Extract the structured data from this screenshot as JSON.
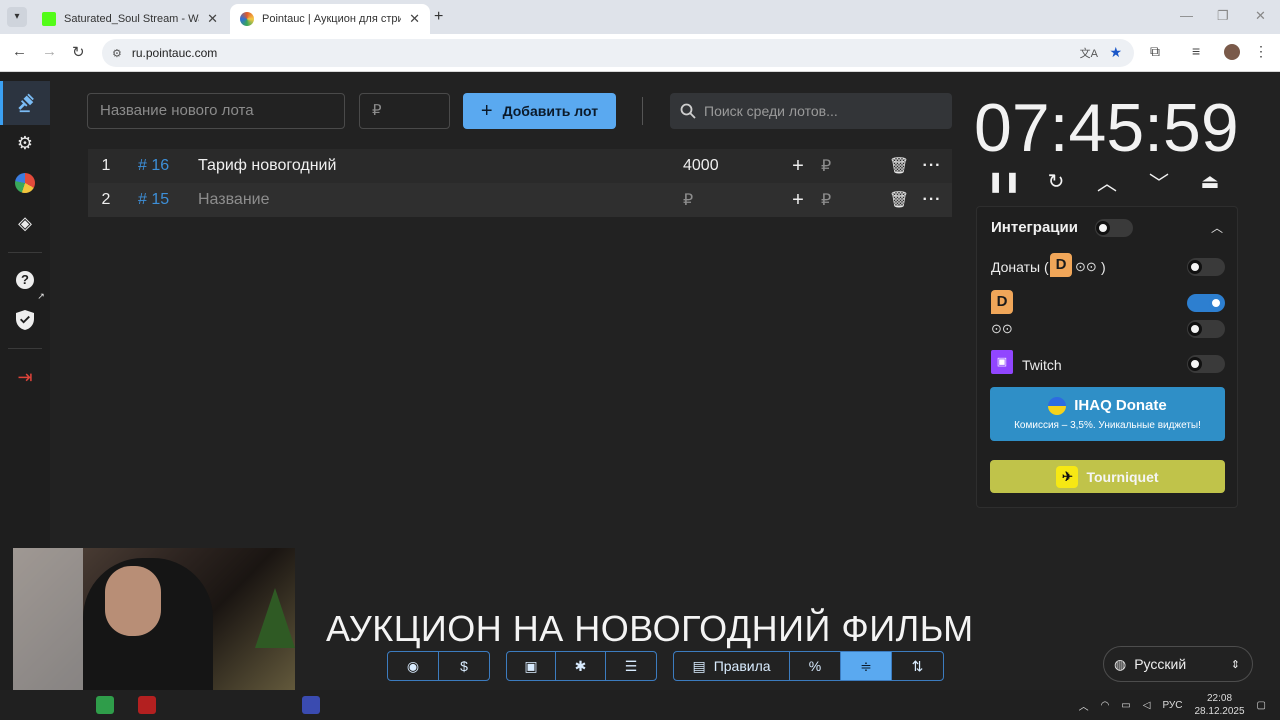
{
  "browser": {
    "tabs": [
      {
        "title": "Saturated_Soul Stream - Watch",
        "favicon_color": "#53fc18"
      },
      {
        "title": "Pointauc | Аукцион для стриме",
        "favicon_color": "#e05a2b"
      }
    ],
    "url": "ru.pointauc.com"
  },
  "toolbar": {
    "name_placeholder": "Название нового лота",
    "amount_placeholder": "₽",
    "add_label": "Добавить лот",
    "search_placeholder": "Поиск среди лотов..."
  },
  "lots": [
    {
      "index": "1",
      "id": "# 16",
      "name": "Тариф новогодний",
      "amount": "4000",
      "currency": "₽"
    },
    {
      "index": "2",
      "id": "# 15",
      "name": "Название",
      "amount": "₽",
      "currency": "₽"
    }
  ],
  "timer": {
    "value": "07:45:59"
  },
  "integrations": {
    "title": "Интеграции",
    "donations_label": "Донаты (",
    "donations_suffix": ")",
    "donationalerts_on": true,
    "twitch_label": "Twitch",
    "ihaq_title": "IHAQ Donate",
    "ihaq_subtitle": "Комиссия – 3,5%. Уникальные виджеты!",
    "tourniquet_label": "Tourniquet"
  },
  "banner": "АУКЦИОН НА НОВОГОДНИЙ ФИЛЬМ",
  "bottom": {
    "rules_label": "Правила",
    "language": "Русский"
  },
  "taskbar": {
    "lang": "РУС",
    "time": "22:08",
    "date": "28.12.2025"
  },
  "colors": {
    "accent": "#5aa9f0",
    "link": "#3d8fd8",
    "ihaq": "#2f8fc7",
    "tourniquet": "#c0c34a"
  }
}
